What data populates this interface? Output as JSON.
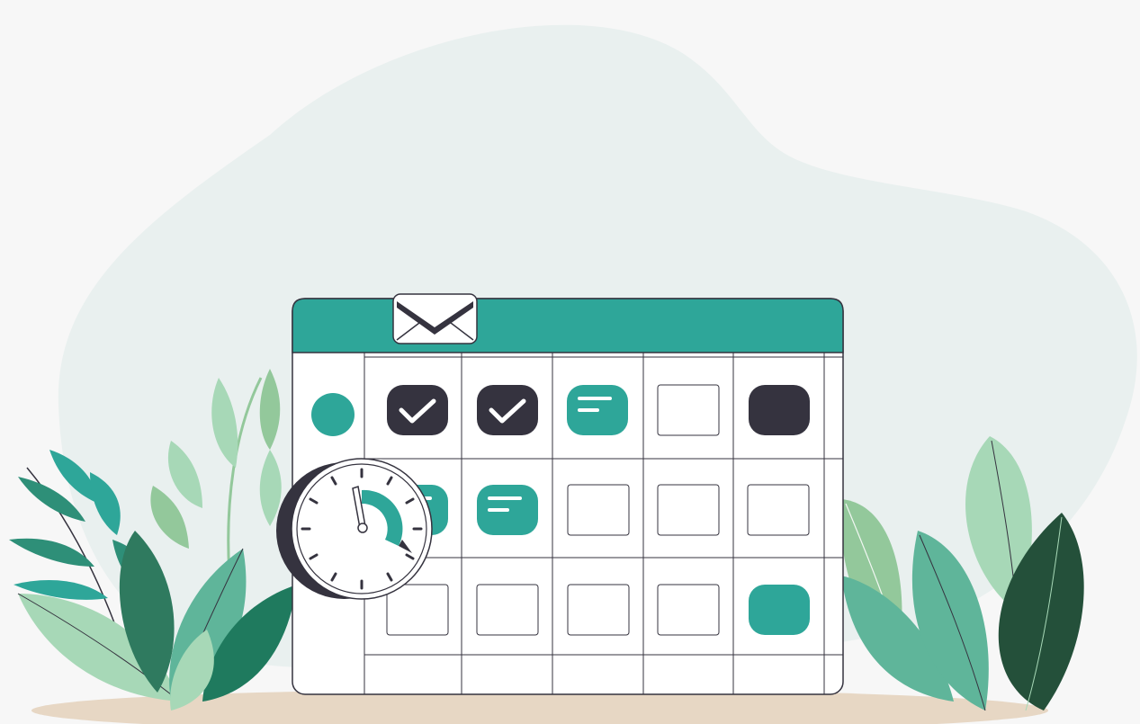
{
  "palette": {
    "background": "#f7f7f7",
    "blob": "#e9f0ef",
    "teal": "#2ea699",
    "dark": "#35333f",
    "outline": "#35333f",
    "white": "#ffffff",
    "ground": "#e7d7c4",
    "leaf_light": "#a7d8b7",
    "leaf_mid": "#5fb59a",
    "leaf_sage": "#93c89b",
    "leaf_dark": "#2f7a5f",
    "leaf_deep": "#24503a"
  },
  "icons": {
    "envelope": "envelope-icon",
    "clock": "stopwatch-icon",
    "check": "checkmark-icon",
    "note": "note-lines-icon"
  },
  "calendar": {
    "header_color": "#2ea699",
    "grid": [
      [
        "dot",
        "check",
        "check",
        "note",
        "empty",
        "filled-dark"
      ],
      [
        "blank",
        "note",
        "note",
        "empty",
        "empty",
        "empty"
      ],
      [
        "blank",
        "empty",
        "empty",
        "empty",
        "empty",
        "filled-teal"
      ]
    ]
  }
}
